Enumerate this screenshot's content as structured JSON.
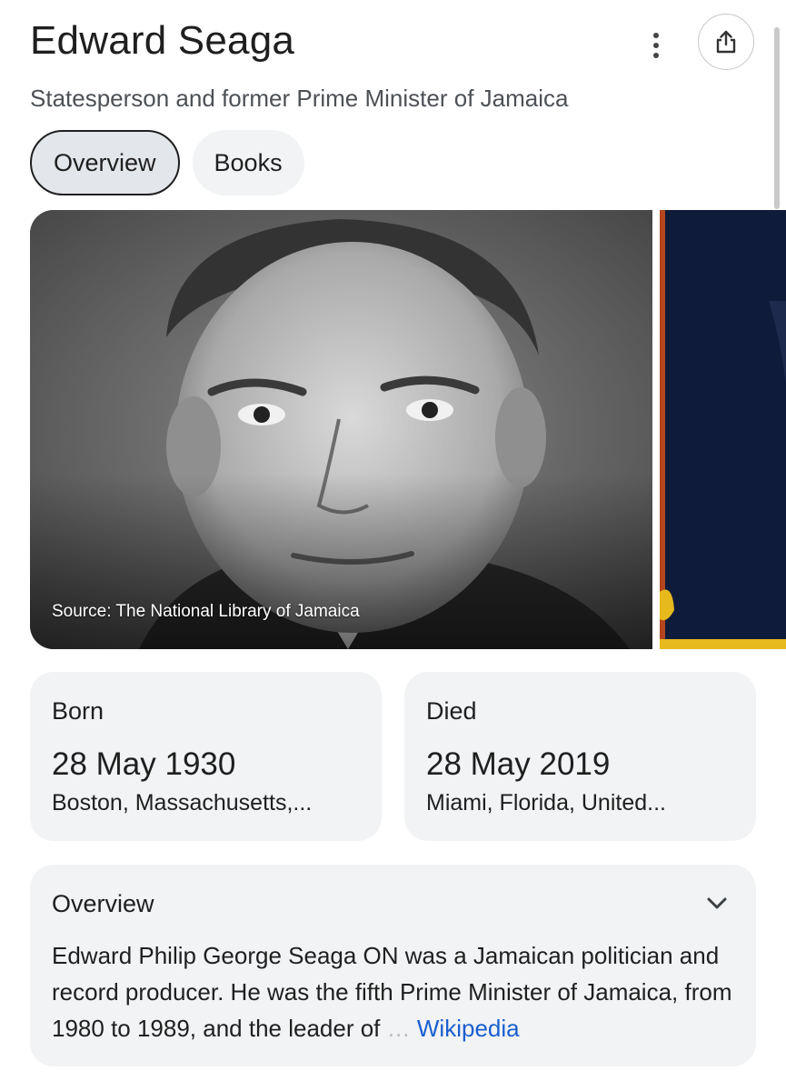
{
  "header": {
    "title": "Edward Seaga",
    "subtitle": "Statesperson and former Prime Minister of Jamaica",
    "more_icon": "more-vert-icon",
    "share_icon": "share-icon"
  },
  "tabs": [
    {
      "label": "Overview",
      "active": true
    },
    {
      "label": "Books",
      "active": false
    }
  ],
  "images": {
    "main_caption": "Source: The National Library of Jamaica"
  },
  "facts": {
    "born": {
      "label": "Born",
      "date": "28 May 1930",
      "place": "Boston, Massachusetts,..."
    },
    "died": {
      "label": "Died",
      "date": "28 May 2019",
      "place": "Miami, Florida, United..."
    }
  },
  "overview": {
    "title": "Overview",
    "text": "Edward Philip George Seaga ON was a Jamaican politician and record producer. He was the fifth Prime Minister of Jamaica, from 1980 to 1989, and the leader of",
    "ellipsis": "…",
    "source_link": "Wikipedia",
    "expand_icon": "chevron-down-icon"
  }
}
